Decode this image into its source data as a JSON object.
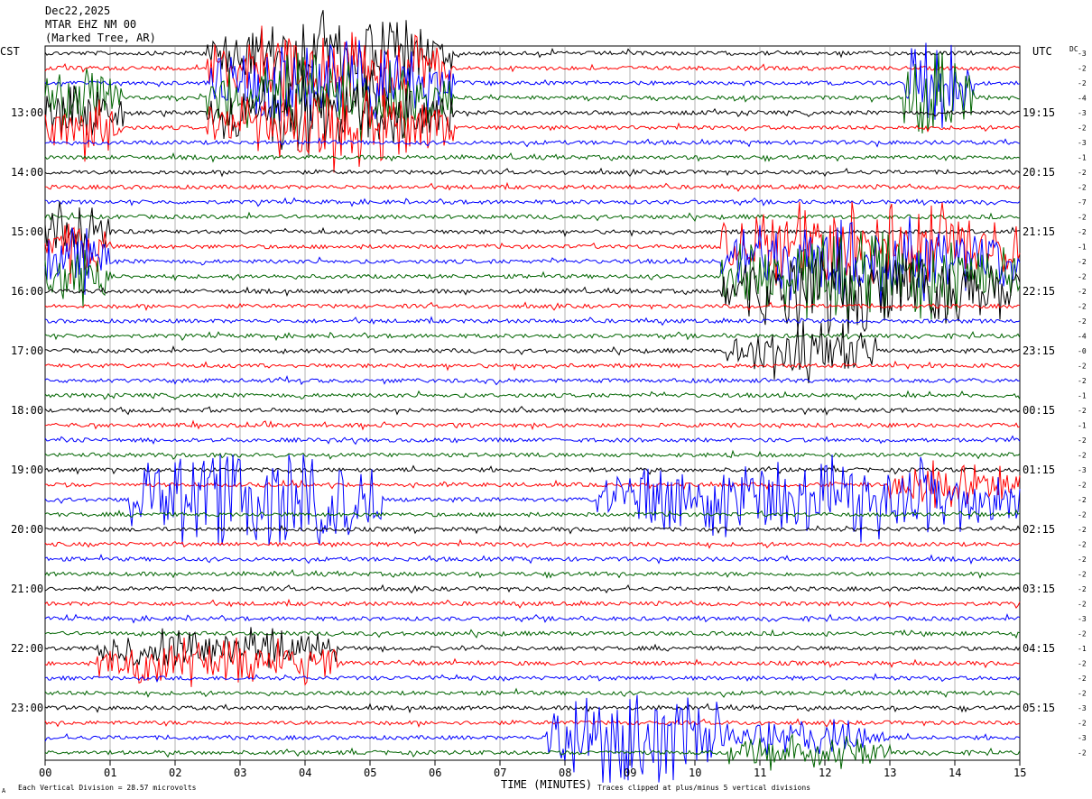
{
  "header": {
    "date": "Dec22,2025",
    "station": "MTAR EHZ NM 00",
    "location": "(Marked Tree, AR)"
  },
  "labels": {
    "left_zone": "CST",
    "right_zone": "UTC",
    "dc_header": "DC",
    "xlabel": "TIME (MINUTES)",
    "division_note": "Each Vertical Division =   28.57 microvolts",
    "clip_note": "Traces clipped at plus/minus 5 vertical divisions",
    "corner_mark": "A"
  },
  "chart_data": {
    "type": "line",
    "xlim": [
      0,
      15
    ],
    "x_ticks": [
      "00",
      "01",
      "02",
      "03",
      "04",
      "05",
      "06",
      "07",
      "08",
      "09",
      "10",
      "11",
      "12",
      "13",
      "14",
      "15"
    ],
    "rows": 48,
    "row_minutes": 15,
    "trace_colors": [
      "#000000",
      "#ff0000",
      "#0000ff",
      "#006400"
    ],
    "left_hour_labels": [
      "13:00",
      "14:00",
      "15:00",
      "16:00",
      "17:00",
      "18:00",
      "19:00",
      "20:00",
      "21:00",
      "22:00",
      "23:00"
    ],
    "right_hour_labels": [
      "19:15",
      "20:15",
      "21:15",
      "22:15",
      "23:15",
      "00:15",
      "01:15",
      "02:15",
      "03:15",
      "04:15",
      "05:15"
    ],
    "hour_label_first_row": 4,
    "dc_offsets": [
      "-3",
      "-2",
      "-2",
      "-4",
      "-3",
      "-2",
      "-3",
      "-1",
      "-2",
      "-2",
      "-7",
      "-2",
      "-2",
      "-1",
      "-2",
      "-2",
      "-2",
      "-2",
      "-2",
      "-4",
      "-0",
      "-2",
      "-2",
      "-1",
      "-2",
      "-1",
      "-2",
      "-2",
      "-3",
      "-2",
      "-2",
      "-2",
      "-2",
      "-2",
      "-2",
      "-2",
      "-2",
      "-2",
      "-3",
      "-2",
      "-1",
      "-2",
      "-2",
      "-2",
      "-3",
      "-2",
      "-3",
      "-2"
    ],
    "events": [
      {
        "rows": [
          0,
          1,
          2,
          3,
          4,
          5
        ],
        "x_start": 2.5,
        "x_end": 6.3,
        "amp": 1.2
      },
      {
        "rows": [
          2,
          3
        ],
        "x_start": 13.2,
        "x_end": 14.3,
        "amp": 1.4
      },
      {
        "rows": [
          3,
          4,
          5
        ],
        "x_start": 0,
        "x_end": 1.2,
        "amp": 0.9
      },
      {
        "rows": [
          13,
          14,
          15,
          16
        ],
        "x_start": 10.4,
        "x_end": 15,
        "amp": 1.3
      },
      {
        "rows": [
          12,
          13,
          14,
          15
        ],
        "x_start": 0,
        "x_end": 1.0,
        "amp": 0.9
      },
      {
        "rows": [
          20
        ],
        "x_start": 10.5,
        "x_end": 12.8,
        "amp": 0.8
      },
      {
        "rows": [
          30
        ],
        "x_start": 1.3,
        "x_end": 5.2,
        "amp": 1.5
      },
      {
        "rows": [
          30
        ],
        "x_start": 8.5,
        "x_end": 15,
        "amp": 1.2
      },
      {
        "rows": [
          29
        ],
        "x_start": 13.0,
        "x_end": 15,
        "amp": 0.6
      },
      {
        "rows": [
          40,
          41
        ],
        "x_start": 0.8,
        "x_end": 4.5,
        "amp": 0.7
      },
      {
        "rows": [
          46
        ],
        "x_start": 7.7,
        "x_end": 10.5,
        "amp": 1.5
      },
      {
        "rows": [
          47,
          46
        ],
        "x_start": 10.5,
        "x_end": 13.0,
        "amp": 0.5
      }
    ]
  }
}
